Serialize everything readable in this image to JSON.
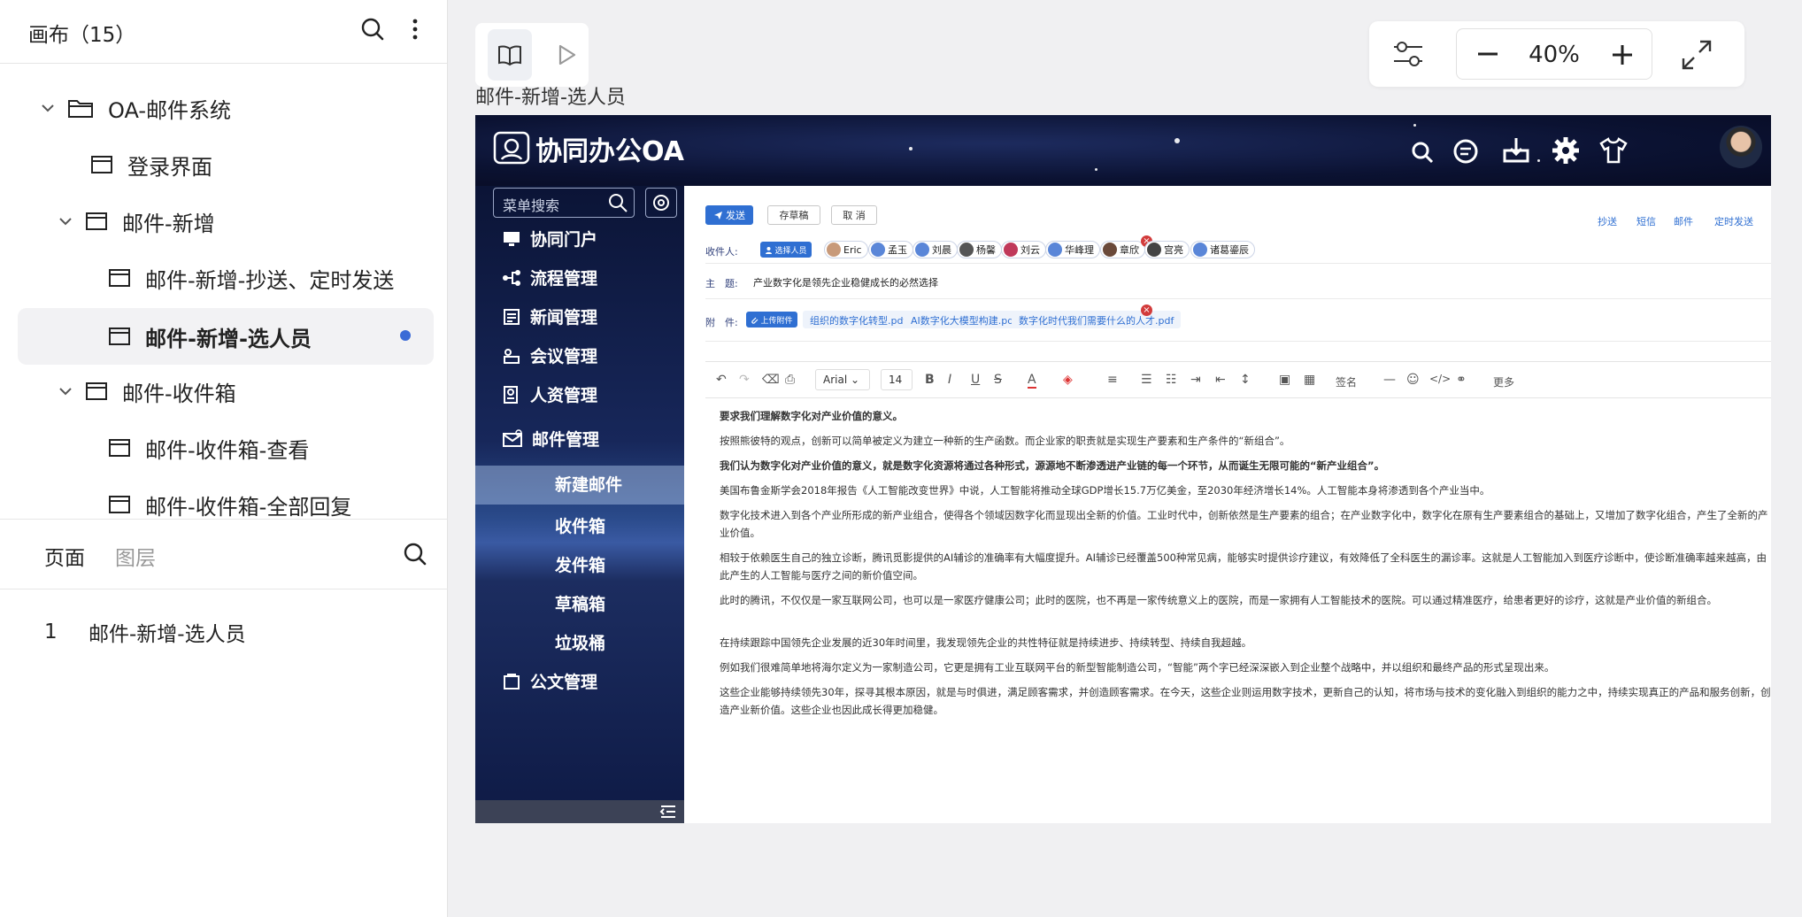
{
  "left_panel": {
    "title": "画布（15）",
    "tree": [
      {
        "label": "OA-邮件系统",
        "icon": "folder-icon",
        "level": 0
      },
      {
        "label": "登录界面",
        "icon": "page-icon",
        "level": 1
      },
      {
        "label": "邮件-新增",
        "icon": "page-icon",
        "level": 1
      },
      {
        "label": "邮件-新增-抄送、定时发送",
        "icon": "page-icon",
        "level": 2
      },
      {
        "label": "邮件-新增-选人员",
        "icon": "page-icon",
        "level": 2,
        "selected": true
      },
      {
        "label": "邮件-收件箱",
        "icon": "page-icon",
        "level": 1
      },
      {
        "label": "邮件-收件箱-查看",
        "icon": "page-icon",
        "level": 2
      },
      {
        "label": "邮件-收件箱-全部回复",
        "icon": "page-icon",
        "level": 2
      }
    ],
    "tabs": {
      "pages": "页面",
      "layers": "图层"
    },
    "page_list": [
      {
        "num": "1",
        "label": "邮件-新增-选人员"
      }
    ]
  },
  "canvas": {
    "artboard_label": "邮件-新增-选人员",
    "zoom": "40%"
  },
  "oa": {
    "logo_text": "协同办公OA",
    "menu_search_placeholder": "菜单搜索",
    "menu": [
      {
        "label": "协同门户",
        "icon": "monitor-icon"
      },
      {
        "label": "流程管理",
        "icon": "flow-icon"
      },
      {
        "label": "新闻管理",
        "icon": "news-icon"
      },
      {
        "label": "会议管理",
        "icon": "meeting-icon"
      },
      {
        "label": "人资管理",
        "icon": "hr-icon"
      },
      {
        "label": "邮件管理",
        "icon": "mail-icon"
      },
      {
        "label": "公文管理",
        "icon": "document-icon"
      }
    ],
    "mail_submenu": [
      "新建邮件",
      "收件箱",
      "发件箱",
      "草稿箱",
      "垃圾桶"
    ],
    "form": {
      "send": "发送",
      "save_draft": "存草稿",
      "cancel": "取 消",
      "links": [
        "抄送",
        "短信",
        "邮件",
        "定时发送"
      ],
      "recipients_label": "收件人:",
      "select_people": "选择人员",
      "recipients": [
        "Eric",
        "孟玉",
        "刘晨",
        "杨馨",
        "刘云",
        "华峰理",
        "章欣",
        "宫亮",
        "诸葛鎏辰"
      ],
      "subject_label": "主　题:",
      "subject": "产业数字化是领先企业稳健成长的必然选择",
      "attachment_label": "附　件:",
      "upload": "上传附件",
      "attachments": [
        "组织的数字化转型.pdf",
        "AI数字化大模型构建.pdf",
        "数字化时代我们需要什么的人才.pdf"
      ]
    },
    "editor": {
      "font": "Arial",
      "size": "14",
      "signature": "签名",
      "more": "更多",
      "paragraphs": [
        "要求我们理解数字化对产业价值的意义。",
        "按照熊彼特的观点，创新可以简单被定义为建立一种新的生产函数。而企业家的职责就是实现生产要素和生产条件的“新组合”。",
        "我们认为数字化对产业价值的意义，就是数字化资源将通过各种形式，源源地不断渗透进产业链的每一个环节，从而诞生无限可能的“新产业组合”。",
        "美国布鲁金斯学会2018年报告《人工智能改变世界》中说，人工智能将推动全球GDP增长15.7万亿美金，至2030年经济增长14%。人工智能本身将渗透到各个产业当中。",
        "数字化技术进入到各个产业所形成的新产业组合，使得各个领域因数字化而显现出全新的价值。工业时代中，创新依然是生产要素的组合；在产业数字化中，数字化在原有生产要素组合的基础上，又增加了数字化组合，产生了全新的产业价值。",
        "相较于依赖医生自己的独立诊断，腾讯觅影提供的AI辅诊的准确率有大幅度提升。AI辅诊已经覆盖500种常见病，能够实时提供诊疗建议，有效降低了全科医生的漏诊率。这就是人工智能加入到医疗诊断中，使诊断准确率越来越高，由此产生的人工智能与医疗之间的新价值空间。",
        "此时的腾讯，不仅仅是一家互联网公司，也可以是一家医疗健康公司；此时的医院，也不再是一家传统意义上的医院，而是一家拥有人工智能技术的医院。可以通过精准医疗，给患者更好的诊疗，这就是产业价值的新组合。",
        "在持续跟踪中国领先企业发展的近30年时间里，我发现领先企业的共性特征就是持续进步、持续转型、持续自我超越。",
        "例如我们很难简单地将海尔定义为一家制造公司，它更是拥有工业互联网平台的新型智能制造公司，“智能”两个字已经深深嵌入到企业整个战略中，并以组织和最终产品的形式呈现出来。",
        "这些企业能够持续领先30年，探寻其根本原因，就是与时俱进，满足顾客需求，并创造顾客需求。在今天，这些企业则运用数字技术，更新自己的认知，将市场与技术的变化融入到组织的能力之中，持续实现真正的产品和服务创新，创造产业新价值。这些企业也因此成长得更加稳健。"
      ]
    }
  }
}
